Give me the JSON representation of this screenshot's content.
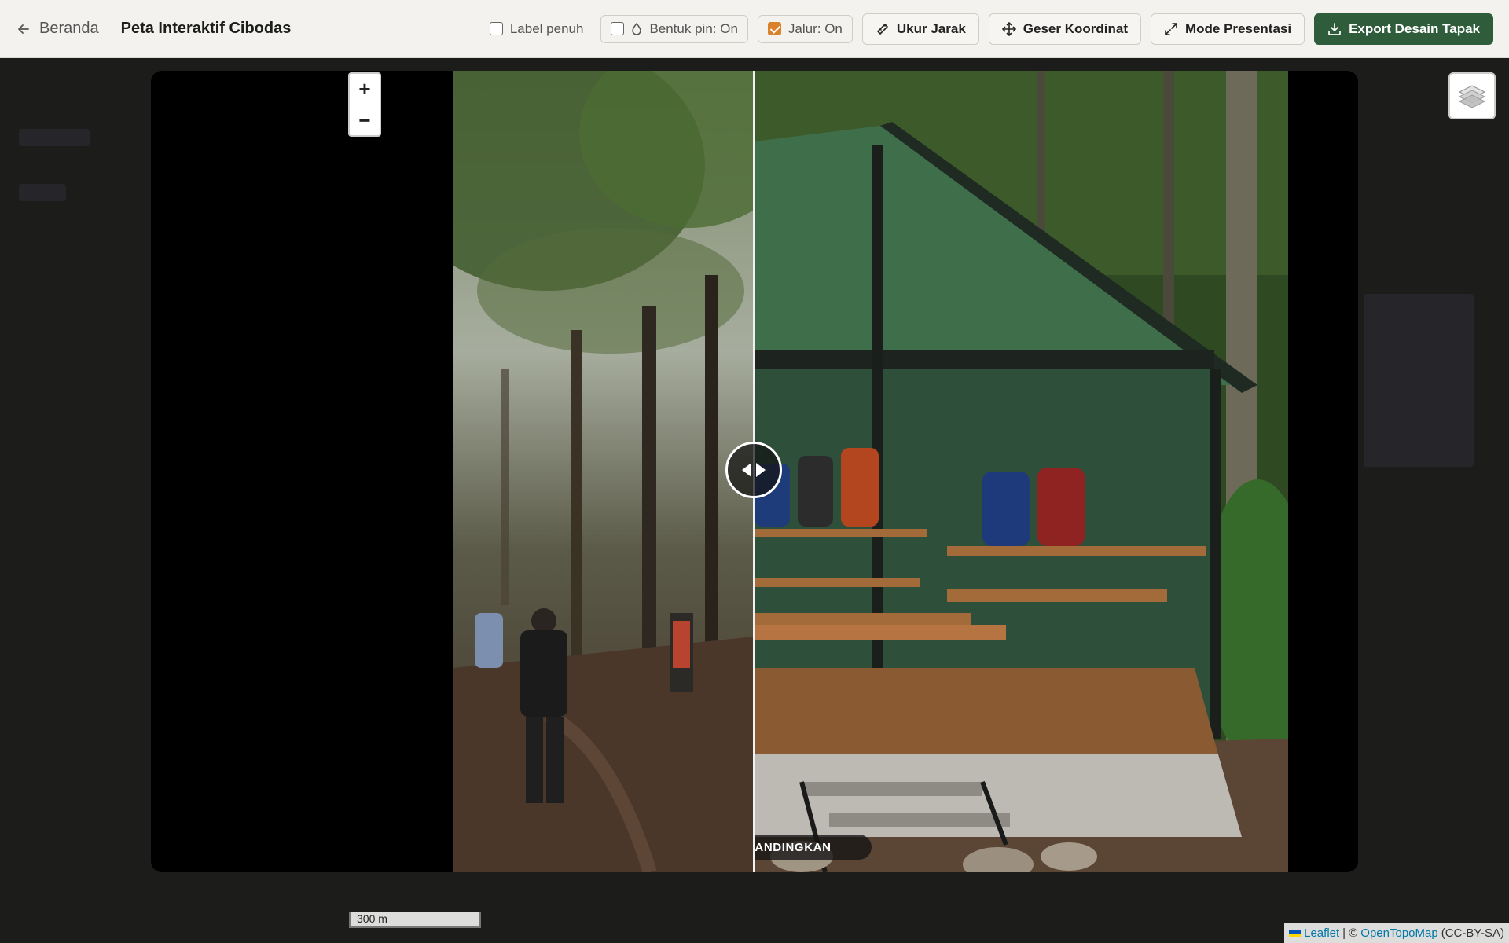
{
  "header": {
    "back_label": "Beranda",
    "title": "Peta Interaktif Cibodas"
  },
  "toolbar": {
    "label_full": "Label penuh",
    "pin_shape": "Bentuk pin: On",
    "trail": "Jalur: On",
    "measure": "Ukur Jarak",
    "move_coord": "Geser Koordinat",
    "presentation": "Mode Presentasi",
    "export": "Export Desain Tapak",
    "label_full_checked": false,
    "pin_shape_checked": false,
    "trail_checked": true
  },
  "viewer": {
    "compare_label": "BANDINGKAN"
  },
  "map": {
    "zoom_in": "+",
    "zoom_out": "−",
    "scale_label": "300 m",
    "attribution_leaflet": "Leaflet",
    "attribution_sep": "| ©",
    "attribution_otm": "OpenTopoMap",
    "attribution_license": "(CC-BY-SA)"
  },
  "colors": {
    "primary": "#2f5d3c",
    "checkbox_on": "#d9822b",
    "link": "#0078a8"
  }
}
